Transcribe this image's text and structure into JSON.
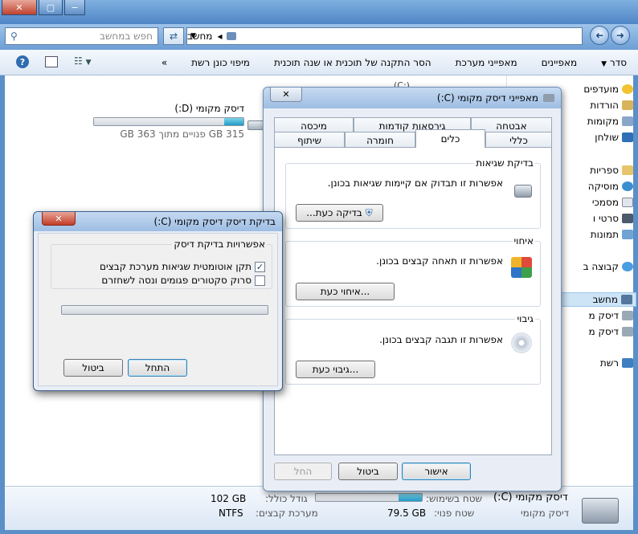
{
  "window": {
    "close_glyph": "✕",
    "maximize_glyph": "▢",
    "minimize_glyph": "−"
  },
  "address": {
    "crumb": "מחשב",
    "search_placeholder": "חפש במחשב"
  },
  "toolbar": {
    "organize": "סדר",
    "properties": "מאפיינים",
    "system_properties": "מאפייני מערכת",
    "uninstall": "הסר התקנה של תוכנית או שנה תוכנית",
    "map_drive": "מיפוי כונן רשת",
    "more": "»"
  },
  "nav": {
    "favorites": "מועדפים",
    "downloads": "הורדות",
    "recent_places": "מקומות",
    "desktop": "שולחן",
    "libraries": "ספריות",
    "music": "מוסיקה",
    "documents": "מסמכי",
    "videos": "סרטי ו",
    "pictures": "תמונות",
    "homegroup": "קבוצה ב",
    "computer": "מחשב",
    "disk1": "דיסק מ",
    "disk2": "דיסק מ",
    "network": "רשת"
  },
  "drive_d": {
    "name": "דיסק מקומי (D:)",
    "free_text": "315 GB פנויים מתוך 363 GB",
    "used_fraction": 0.13
  },
  "details": {
    "drive_name": "דיסק מקומי (C:)",
    "drive_type": "דיסק מקומי",
    "used_label": "שטח בשימוש:",
    "free_label": "שטח פנוי:",
    "free_value": "79.5 GB",
    "total_label": "גודל כולל:",
    "total_value": "102 GB",
    "fs_label": "מערכת קבצים:",
    "fs_value": "NTFS",
    "used_fraction": 0.22
  },
  "properties_dialog": {
    "title": "מאפייני דיסק מקומי (C:)",
    "tabs_row1": [
      "אבטחה",
      "גירסאות קודמות",
      "מיכסה"
    ],
    "tabs_row2": [
      "כללי",
      "כלים",
      "חומרה",
      "שיתוף"
    ],
    "error_checking": {
      "title": "בדיקת שגיאות",
      "desc": "אפשרות זו תבדוק אם קיימות שגיאות בכונן.",
      "button": "בדיקה כעת..."
    },
    "defrag": {
      "title": "איחוי",
      "desc": "אפשרות זו תאחה קבצים בכונן.",
      "button": "איחוי כעת..."
    },
    "backup": {
      "title": "גיבוי",
      "desc": "אפשרות זו תגבה קבצים בכונן.",
      "button": "גיבוי כעת..."
    },
    "ok": "אישור",
    "cancel": "ביטול",
    "apply": "החל"
  },
  "check_dialog": {
    "title": "בדיקת דיסק דיסק מקומי (C:)",
    "options_title": "אפשרויות בדיקת דיסק",
    "option1": "תקן אוטומטית שגיאות מערכת קבצים",
    "option1_checked": true,
    "option2": "סרוק סקטורים פגומים ונסה לשחזרם",
    "option2_checked": false,
    "start": "התחל",
    "cancel": "ביטול",
    "close_glyph": "✕"
  },
  "partial": {
    "hidden_label": "(C:)"
  }
}
